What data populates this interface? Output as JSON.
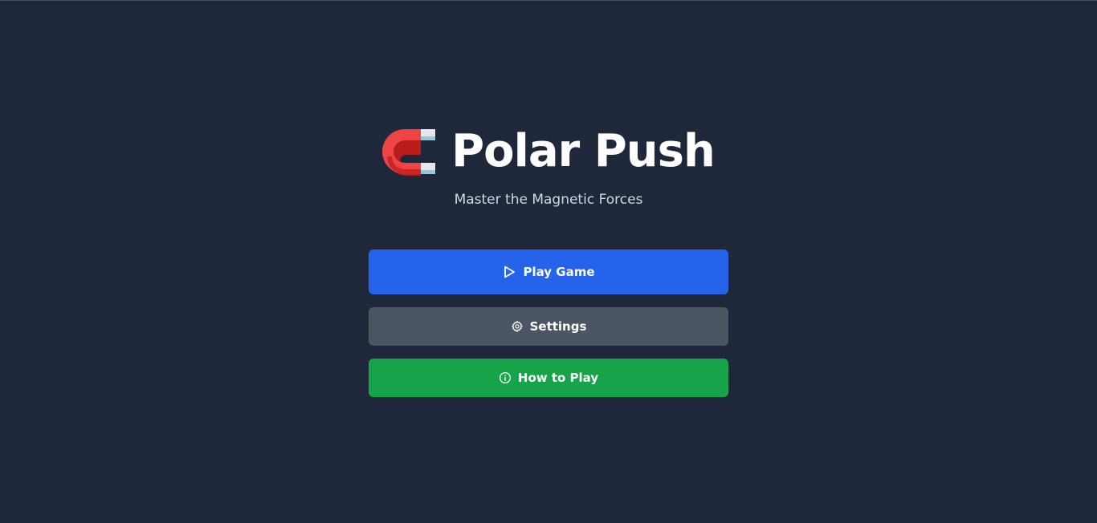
{
  "title": "Polar Push",
  "subtitle": "Master the Magnetic Forces",
  "logo_icon": "magnet-icon",
  "menu": {
    "play": {
      "label": "Play Game",
      "icon": "play-icon",
      "color": "#2563eb"
    },
    "settings": {
      "label": "Settings",
      "icon": "gear-icon",
      "color": "#4b5563"
    },
    "help": {
      "label": "How to Play",
      "icon": "info-icon",
      "color": "#16a34a"
    }
  },
  "colors": {
    "background": "#1f283b",
    "text": "#ffffff",
    "subtitle": "#d2d6de"
  }
}
